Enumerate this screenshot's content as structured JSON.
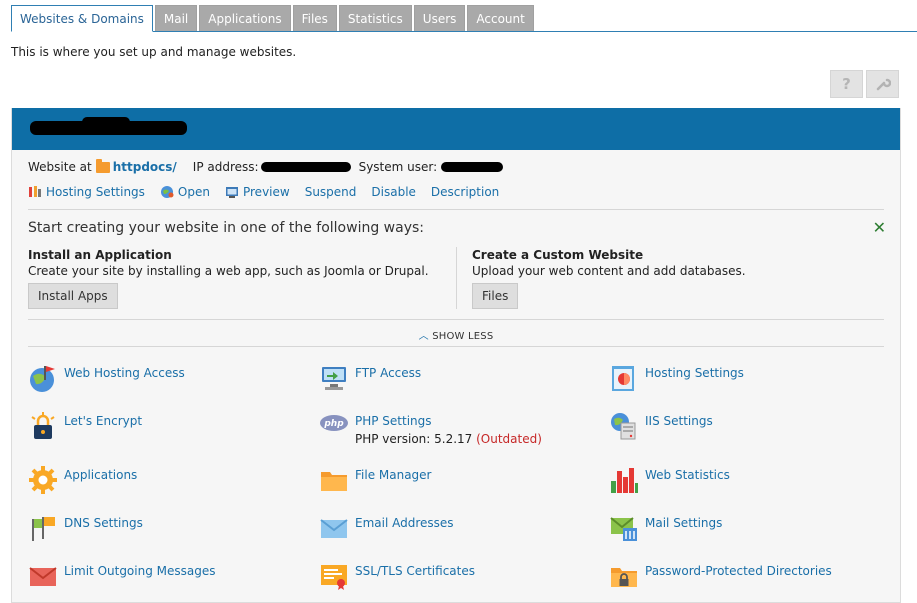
{
  "tabs": [
    {
      "label": "Websites & Domains"
    },
    {
      "label": "Mail"
    },
    {
      "label": "Applications"
    },
    {
      "label": "Files"
    },
    {
      "label": "Statistics"
    },
    {
      "label": "Users"
    },
    {
      "label": "Account"
    }
  ],
  "intro": "This is where you set up and manage websites.",
  "toolbar": {
    "help_icon": "question-mark-icon",
    "settings_icon": "wrench-icon"
  },
  "domain": {
    "website_at_label": "Website at",
    "docroot_link": "httpdocs/",
    "ip_label": "IP address:",
    "system_user_label": "System user:"
  },
  "actions": [
    {
      "label": "Hosting Settings",
      "icon": "hosting-settings-icon"
    },
    {
      "label": "Open",
      "icon": "open-globe-icon"
    },
    {
      "label": "Preview",
      "icon": "preview-icon"
    },
    {
      "label": "Suspend"
    },
    {
      "label": "Disable"
    },
    {
      "label": "Description"
    }
  ],
  "start": {
    "title": "Start creating your website in one of the following ways:",
    "install": {
      "title": "Install an Application",
      "desc": "Create your site by installing a web app, such as Joomla or Drupal.",
      "button": "Install Apps"
    },
    "custom": {
      "title": "Create a Custom Website",
      "desc": "Upload your web content and add databases.",
      "button": "Files"
    },
    "show_less": "SHOW LESS"
  },
  "tools": [
    {
      "label": "Web Hosting Access",
      "icon": "globe-flag-icon"
    },
    {
      "label": "FTP Access",
      "icon": "ftp-icon"
    },
    {
      "label": "Hosting Settings",
      "icon": "hosting-settings-icon"
    },
    {
      "label": "Let's Encrypt",
      "icon": "lets-encrypt-icon"
    },
    {
      "label": "PHP Settings",
      "icon": "php-icon",
      "sub_prefix": "PHP version: 5.2.17 ",
      "sub_warn": "(Outdated)"
    },
    {
      "label": "IIS Settings",
      "icon": "iis-icon"
    },
    {
      "label": "Applications",
      "icon": "gear-icon"
    },
    {
      "label": "File Manager",
      "icon": "folder-icon"
    },
    {
      "label": "Web Statistics",
      "icon": "bar-chart-icon"
    },
    {
      "label": "DNS Settings",
      "icon": "dns-flags-icon"
    },
    {
      "label": "Email Addresses",
      "icon": "envelope-icon"
    },
    {
      "label": "Mail Settings",
      "icon": "mail-settings-icon"
    },
    {
      "label": "Limit Outgoing Messages",
      "icon": "limit-mail-icon"
    },
    {
      "label": "SSL/TLS Certificates",
      "icon": "certificate-icon"
    },
    {
      "label": "Password-Protected Directories",
      "icon": "protected-folder-icon"
    }
  ],
  "colors": {
    "header": "#0e6ea6",
    "link": "#1a6fa8",
    "warning": "#c62828"
  }
}
